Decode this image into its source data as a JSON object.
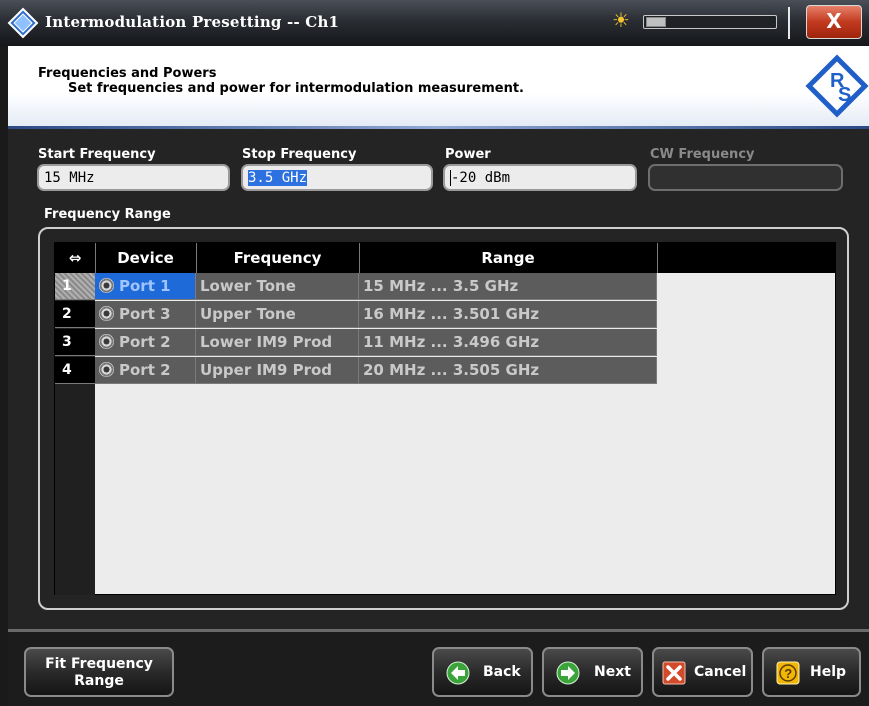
{
  "window": {
    "title": "Intermodulation Presetting -- Ch1",
    "close_label": "X"
  },
  "header": {
    "title": "Frequencies and Powers",
    "subtitle": "Set frequencies and power for intermodulation measurement."
  },
  "fields": {
    "start_frequency": {
      "label": "Start Frequency",
      "value": "15 MHz"
    },
    "stop_frequency": {
      "label": "Stop Frequency",
      "value": "3.5 GHz"
    },
    "power": {
      "label": "Power",
      "value": "-20 dBm"
    },
    "cw_frequency": {
      "label": "CW Frequency",
      "value": ""
    }
  },
  "frequency_range": {
    "label": "Frequency Range",
    "columns": [
      "Device",
      "Frequency",
      "Range"
    ],
    "rows": [
      {
        "num": "1",
        "device": "Port 1",
        "frequency": "Lower Tone",
        "range": "15 MHz ... 3.5 GHz"
      },
      {
        "num": "2",
        "device": "Port 3",
        "frequency": "Upper Tone",
        "range": "16 MHz ... 3.501 GHz"
      },
      {
        "num": "3",
        "device": "Port 2",
        "frequency": "Lower IM9 Prod",
        "range": "11 MHz ... 3.496 GHz"
      },
      {
        "num": "4",
        "device": "Port 2",
        "frequency": "Upper IM9 Prod",
        "range": "20 MHz ... 3.505 GHz"
      }
    ]
  },
  "buttons": {
    "fit_line1": "Fit Frequency",
    "fit_line2": "Range",
    "back": "Back",
    "next": "Next",
    "cancel": "Cancel",
    "help": "Help"
  },
  "icons": {
    "app": "rs-diamond-icon",
    "brightness": "sun-icon",
    "back": "arrow-left-icon",
    "next": "arrow-right-icon",
    "cancel": "x-icon",
    "help": "question-icon",
    "port": "port-connector-icon"
  },
  "colors": {
    "selection": "#2d70e0",
    "active_cell": "#1e6ad9",
    "close": "#c13a1f",
    "help": "#f2b705"
  }
}
